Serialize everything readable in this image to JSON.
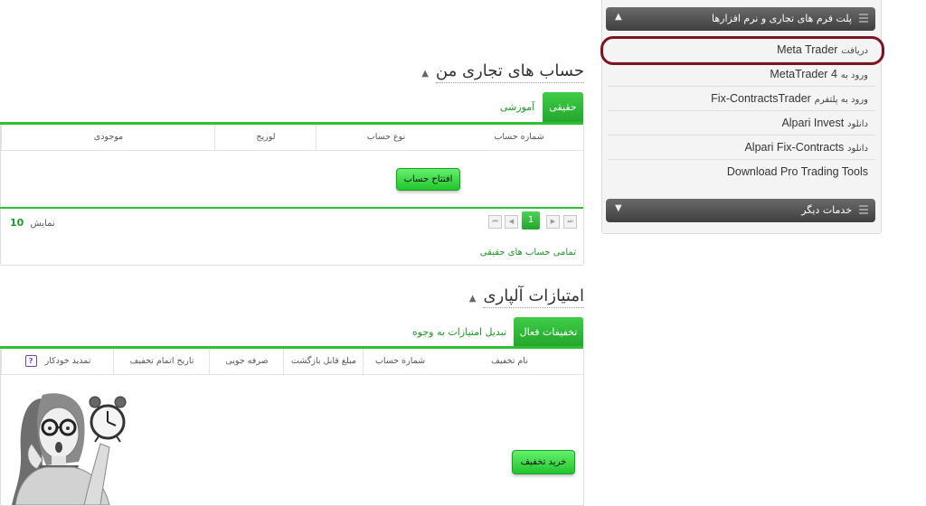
{
  "sidebar": {
    "header_top": "پلت فرم های تجاری و نرم افزارها",
    "header_bottom": "خدمات دیگر",
    "items": [
      {
        "prefix": "دریافت",
        "label": "Meta Trader"
      },
      {
        "prefix": "ورود به",
        "label": "MetaTrader 4"
      },
      {
        "prefix": "ورود به پلتفرم",
        "label": "Fix-ContractsTrader"
      },
      {
        "prefix": "دانلود",
        "label": "Alpari Invest"
      },
      {
        "prefix": "دانلود",
        "label": "Alpari Fix-Contracts"
      },
      {
        "prefix": "",
        "label": "Download Pro Trading Tools"
      }
    ]
  },
  "accounts": {
    "title": "حساب های تجاری من",
    "tabs": [
      "حقیقی",
      "آموزشی"
    ],
    "columns": [
      "شماره حساب",
      "نوع حساب",
      "لوریج",
      "موجودی"
    ],
    "open_button": "افتتاح حساب",
    "pagination": {
      "current_page": "1"
    },
    "show_label": "نمایش",
    "show_count": "10",
    "all_link": "تمامی حساب های حقیقی"
  },
  "bonus": {
    "title": "امتیازات آلپاری",
    "tabs": [
      "تخفیفات فعال",
      "تبدیل امتیازات به وجوه"
    ],
    "columns": [
      "نام تخفیف",
      "شماره حساب",
      "مبلغ قابل بازگشت",
      "صرفه جویی",
      "تاریخ اتمام تخفیف",
      "تمدید خودکار"
    ],
    "help_icon": "?",
    "buy_button": "خرید تخفیف"
  },
  "colors": {
    "accent_green": "#22a62b",
    "highlight": "#7d1424",
    "panel_header": "#4a4a4a"
  }
}
